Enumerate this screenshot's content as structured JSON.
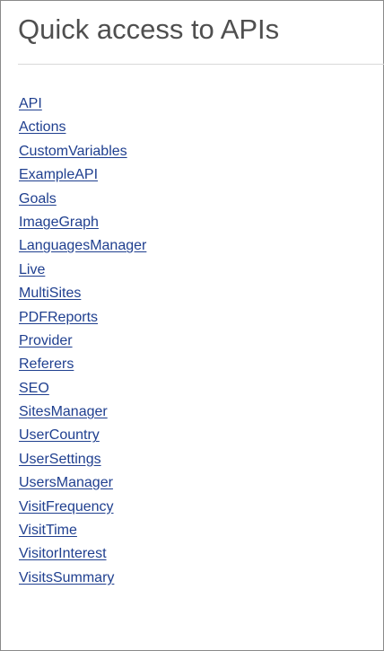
{
  "heading": "Quick access to APIs",
  "colors": {
    "heading": "#4f4f4f",
    "link": "#1f3f8f",
    "border": "#8a8a8a",
    "rule": "#d9d9d9"
  },
  "apis": [
    "API",
    "Actions",
    "CustomVariables",
    "ExampleAPI",
    "Goals",
    "ImageGraph",
    "LanguagesManager",
    "Live",
    "MultiSites",
    "PDFReports",
    "Provider",
    "Referers",
    "SEO",
    "SitesManager",
    "UserCountry",
    "UserSettings",
    "UsersManager",
    "VisitFrequency",
    "VisitTime",
    "VisitorInterest",
    "VisitsSummary"
  ]
}
